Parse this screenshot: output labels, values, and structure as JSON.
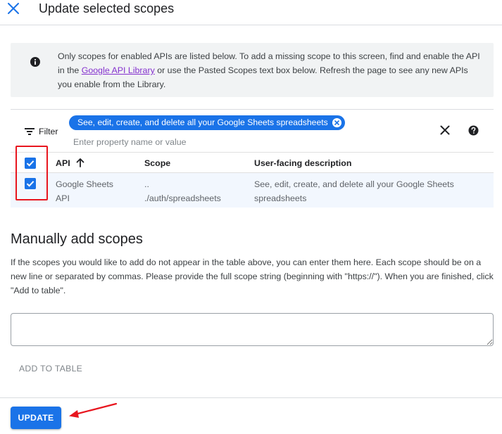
{
  "dialog": {
    "title": "Update selected scopes",
    "close_icon": "close-icon"
  },
  "info": {
    "icon": "info-icon",
    "text_before_link": "Only scopes for enabled APIs are listed below. To add a missing scope to this screen, find and enable the API in the ",
    "link_text": "Google API Library",
    "text_after_link": " or use the Pasted Scopes text box below. Refresh the page to see any new APIs you enable from the Library."
  },
  "filter": {
    "label": "Filter",
    "icon": "filter-icon",
    "chip_label": "See, edit, create, and delete all your Google Sheets spreadsheets",
    "input_placeholder": "Enter property name or value",
    "clear_icon": "close-icon",
    "help_icon": "help-icon"
  },
  "table": {
    "columns": {
      "api": "API",
      "scope": "Scope",
      "description": "User-facing description"
    },
    "sort_icon": "arrow-upward-icon",
    "header_checked": true,
    "rows": [
      {
        "checked": true,
        "api_line1": "Google Sheets",
        "api_line2": "API",
        "scope_line1": "..",
        "scope_line2": "./auth/spreadsheets",
        "desc_line1": "See, edit, create, and delete all your Google Sheets",
        "desc_line2": "spreadsheets"
      }
    ]
  },
  "manual": {
    "title": "Manually add scopes",
    "description": "If the scopes you would like to add do not appear in the table above, you can enter them here. Each scope should be on a new line or separated by commas. Please provide the full scope string (beginning with \"https://\"). When you are finished, click \"Add to table\".",
    "textarea_value": "",
    "add_button": "ADD TO TABLE"
  },
  "footer": {
    "update_button": "UPDATE"
  },
  "colors": {
    "accent": "#1a73e8",
    "annotation": "#e8161f",
    "link": "#8430ce",
    "info_bg": "#f1f3f4",
    "selected_row_bg": "#f2f7fe"
  }
}
